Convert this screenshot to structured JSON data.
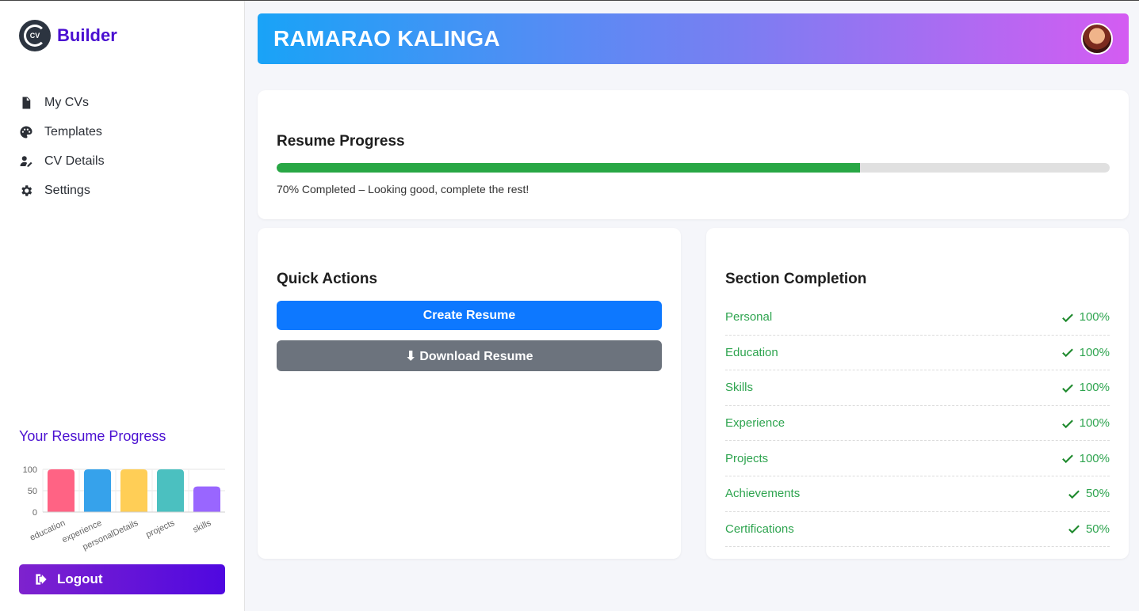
{
  "brand": {
    "logo_text": "CV",
    "name": "Builder"
  },
  "sidebar": {
    "items": [
      {
        "label": "My CVs",
        "icon": "file-icon"
      },
      {
        "label": "Templates",
        "icon": "palette-icon"
      },
      {
        "label": "CV Details",
        "icon": "user-edit-icon"
      },
      {
        "label": "Settings",
        "icon": "gear-icon"
      }
    ],
    "progress_title": "Your Resume Progress",
    "logout_label": "Logout"
  },
  "chart_data": {
    "type": "bar",
    "categories": [
      "education",
      "experience",
      "personalDetails",
      "projects",
      "skills"
    ],
    "values": [
      100,
      100,
      100,
      100,
      60
    ],
    "colors": [
      "#ff6384",
      "#36a2eb",
      "#ffce56",
      "#4bc0c0",
      "#9966ff"
    ],
    "ylim": [
      0,
      100
    ],
    "yticks": [
      0,
      50,
      100
    ],
    "grid": true
  },
  "header": {
    "name": "RAMARAO KALINGA"
  },
  "progress": {
    "title": "Resume Progress",
    "percent": 70,
    "text": "70% Completed – Looking good, complete the rest!"
  },
  "quick_actions": {
    "title": "Quick Actions",
    "create_label": "Create Resume",
    "download_label": "⬇ Download Resume"
  },
  "sections": {
    "title": "Section Completion",
    "rows": [
      {
        "name": "Personal",
        "value": "100%"
      },
      {
        "name": "Education",
        "value": "100%"
      },
      {
        "name": "Skills",
        "value": "100%"
      },
      {
        "name": "Experience",
        "value": "100%"
      },
      {
        "name": "Projects",
        "value": "100%"
      },
      {
        "name": "Achievements",
        "value": "50%"
      },
      {
        "name": "Certifications",
        "value": "50%"
      }
    ]
  },
  "colors": {
    "accent": "#4a0fd1",
    "success": "#28a745",
    "primary_button": "#0d78ff",
    "secondary_button": "#6c737d"
  }
}
